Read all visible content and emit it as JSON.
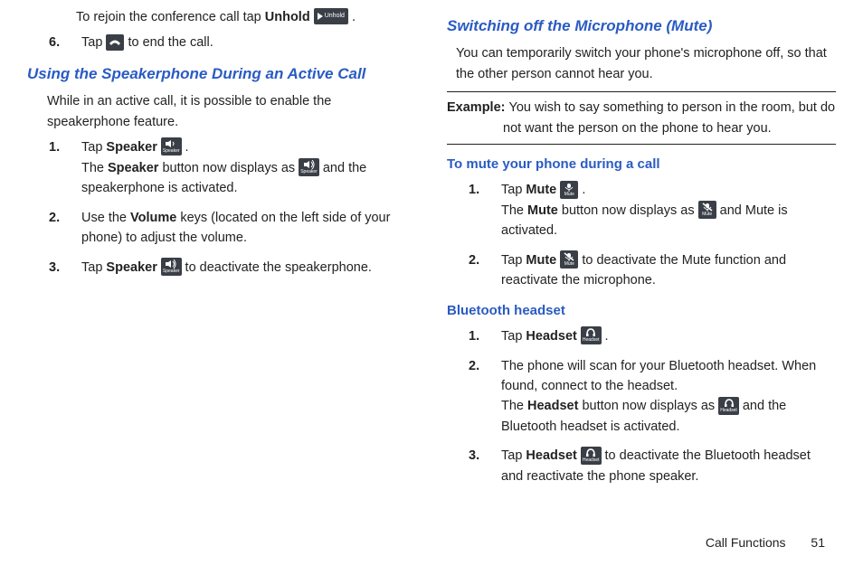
{
  "left": {
    "intro_rejoin_a": "To rejoin the conference call tap ",
    "bold_unhold": "Unhold",
    "icons": {
      "unhold_label": "Unhold"
    },
    "period": " .",
    "step6_a": "Tap ",
    "step6_b": " to end the call.",
    "h2_speaker": "Using the Speakerphone During an Active Call",
    "speaker_intro": "While in an active call, it is possible to enable the speakerphone feature.",
    "sp_step1_a": "Tap ",
    "sp_step1_bold": "Speaker",
    "sp_step1_b": " .",
    "sp_step1_line2a": "The ",
    "sp_step1_line2bold": "Speaker",
    "sp_step1_line2b": " button now displays as ",
    "sp_step1_line2c": " and the speakerphone is activated.",
    "sp_step2_a": "Use the ",
    "sp_step2_bold": "Volume",
    "sp_step2_b": " keys (located on the left side of your phone) to adjust the volume.",
    "sp_step3_a": "Tap ",
    "sp_step3_bold": "Speaker",
    "sp_step3_b": " to deactivate the speakerphone.",
    "speaker_label": "Speaker"
  },
  "right": {
    "h2_mute": "Switching off the Microphone (Mute)",
    "mute_intro": "You can temporarily switch your phone's microphone off, so that the other person cannot hear you.",
    "example_bold": "Example: ",
    "example_body": "You wish to say something to person in the room, but do not want the person on the phone to hear you.",
    "h3_mute": "To mute your phone during a call",
    "m_step1_a": "Tap ",
    "m_step1_bold": "Mute",
    "m_step1_b": " .",
    "m_step1_line2a": "The ",
    "m_step1_line2bold": "Mute",
    "m_step1_line2b": " button now displays as ",
    "m_step1_line2c": " and Mute is activated.",
    "m_step2_a": "Tap ",
    "m_step2_bold": "Mute",
    "m_step2_b": " to deactivate the Mute function and reactivate the microphone.",
    "mute_label": "Mute",
    "h3_bt": "Bluetooth headset",
    "b_step1_a": "Tap ",
    "b_step1_bold": "Headset",
    "b_step1_b": " .",
    "b_step2_a": "The phone will scan for your Bluetooth headset. When found, connect to the headset.",
    "b_step2_line2a": "The ",
    "b_step2_line2bold": "Headset",
    "b_step2_line2b": " button now displays as ",
    "b_step2_line2c": " and the Bluetooth headset is activated.",
    "b_step3_a": "Tap ",
    "b_step3_bold": "Headset",
    "b_step3_b": " to deactivate the Bluetooth headset and reactivate the phone speaker.",
    "headset_label": "Headset"
  },
  "footer": {
    "section": "Call Functions",
    "page": "51"
  },
  "nums": {
    "n1": "1.",
    "n2": "2.",
    "n3": "3.",
    "n6": "6."
  }
}
